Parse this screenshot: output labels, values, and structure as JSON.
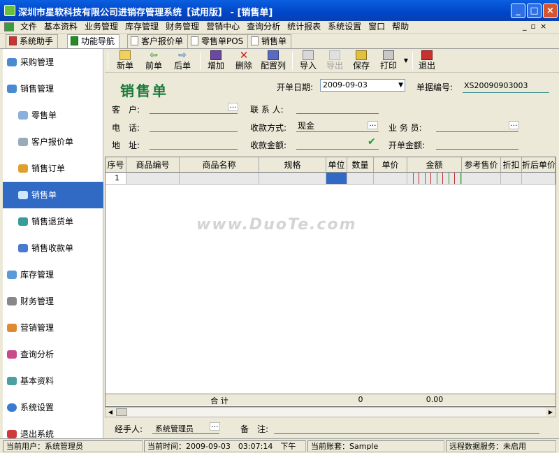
{
  "window": {
    "title": "深圳市星软科技有限公司进销存管理系统【试用版】 - [销售单]"
  },
  "menu": [
    "文件",
    "基本资料",
    "业务管理",
    "库存管理",
    "财务管理",
    "营销中心",
    "查询分析",
    "统计报表",
    "系统设置",
    "窗口",
    "帮助"
  ],
  "tabs": {
    "assistant": "系统助手",
    "nav": "功能导航",
    "doc1": "客户报价单",
    "doc2": "零售单POS",
    "doc3": "销售单"
  },
  "sidebar": {
    "items": [
      "采购管理",
      "销售管理",
      "零售单",
      "客户报价单",
      "销售订单",
      "销售单",
      "销售退货单",
      "销售收款单",
      "库存管理",
      "财务管理",
      "营销管理",
      "查询分析",
      "基本资料",
      "系统设置",
      "退出系统"
    ],
    "selected": "销售单"
  },
  "toolbar": {
    "new": "新单",
    "prev": "前单",
    "next": "后单",
    "add": "增加",
    "delete": "删除",
    "config": "配置列",
    "import": "导入",
    "export": "导出",
    "save": "保存",
    "print": "打印",
    "exit": "退出"
  },
  "form": {
    "title": "销售单",
    "date_label": "开单日期:",
    "date_value": "2009-09-03",
    "docno_label": "单据编号:",
    "docno_value": "XS20090903003",
    "customer_label": "客　户:",
    "contact_label": "联 系 人:",
    "phone_label": "电　话:",
    "payment_label": "收款方式:",
    "payment_value": "现金",
    "salesman_label": "业 务 员:",
    "address_label": "地　址:",
    "received_label": "收款金额:",
    "total_label": "开单金额:"
  },
  "grid": {
    "columns": [
      "序号",
      "商品编号",
      "商品名称",
      "规格",
      "单位",
      "数量",
      "单价",
      "金额",
      "参考售价",
      "折扣",
      "折后单价"
    ],
    "rows": [
      [
        "1",
        "",
        "",
        "",
        "",
        "",
        "",
        "",
        "",
        "",
        ""
      ]
    ],
    "totals": {
      "label": "合  计",
      "qty": "0",
      "amount": "0.00"
    }
  },
  "footer": {
    "handler_label": "经手人:",
    "handler_value": "系统管理员",
    "note_label": "备　注:"
  },
  "status": {
    "user": "当前用户：系统管理员",
    "time": "当前时间：2009-09-03　03:07:14　下午",
    "account": "当前账套：Sample",
    "remote": "远程数据服务：未启用"
  },
  "watermark": "www.DuoTe.com",
  "colors": {
    "selection": "#316ac5",
    "title": "#0a5fe0",
    "form_title": "#1a7a3a",
    "field_line": "#2f8a8a"
  }
}
